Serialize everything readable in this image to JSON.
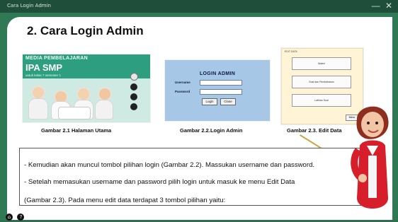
{
  "window": {
    "title": "Cara Login Admin",
    "controls": "—  ✕"
  },
  "page": {
    "heading": "2. Cara Login Admin"
  },
  "figures": [
    {
      "caption": "Gambar 2.1 Halaman Utama",
      "screen": {
        "kicker": "MEDIA PEMBELAJARAN",
        "title": "IPA SMP",
        "subtitle": "untuk kelas 7 semester 1"
      }
    },
    {
      "caption": "Gambar 2.2.Login Admin",
      "screen": {
        "title": "LOGIN ADMIN",
        "username_label": "Username",
        "password_label": "Password",
        "login_button": "Login",
        "close_button": "Close"
      }
    },
    {
      "caption": "Gambar 2.3. Edit Data",
      "screen": {
        "header": "EDIT DATA",
        "buttons": [
          "Materi",
          "Soal dan Pembahasan",
          "Latihan Soal"
        ],
        "menu": "Menu"
      }
    }
  ],
  "text_lines": [
    "- Kemudian akan muncul tombol pilihan login (Gambar 2.2). Massukan username dan password.",
    "- Setelah memasukan username dan password pilih login untuk masuk ke menu Edit Data",
    "  (Gambar 2.3). Pada menu edit data terdapat 3 tombol pilihan yaitu:"
  ],
  "bottom_icons": [
    "home-icon",
    "help-icon"
  ],
  "colors": {
    "titlebar": "#1f4f3b",
    "background": "#2f7a55",
    "gold_pointer": "#c9a646",
    "teacher_jacket": "#d61f2b"
  }
}
